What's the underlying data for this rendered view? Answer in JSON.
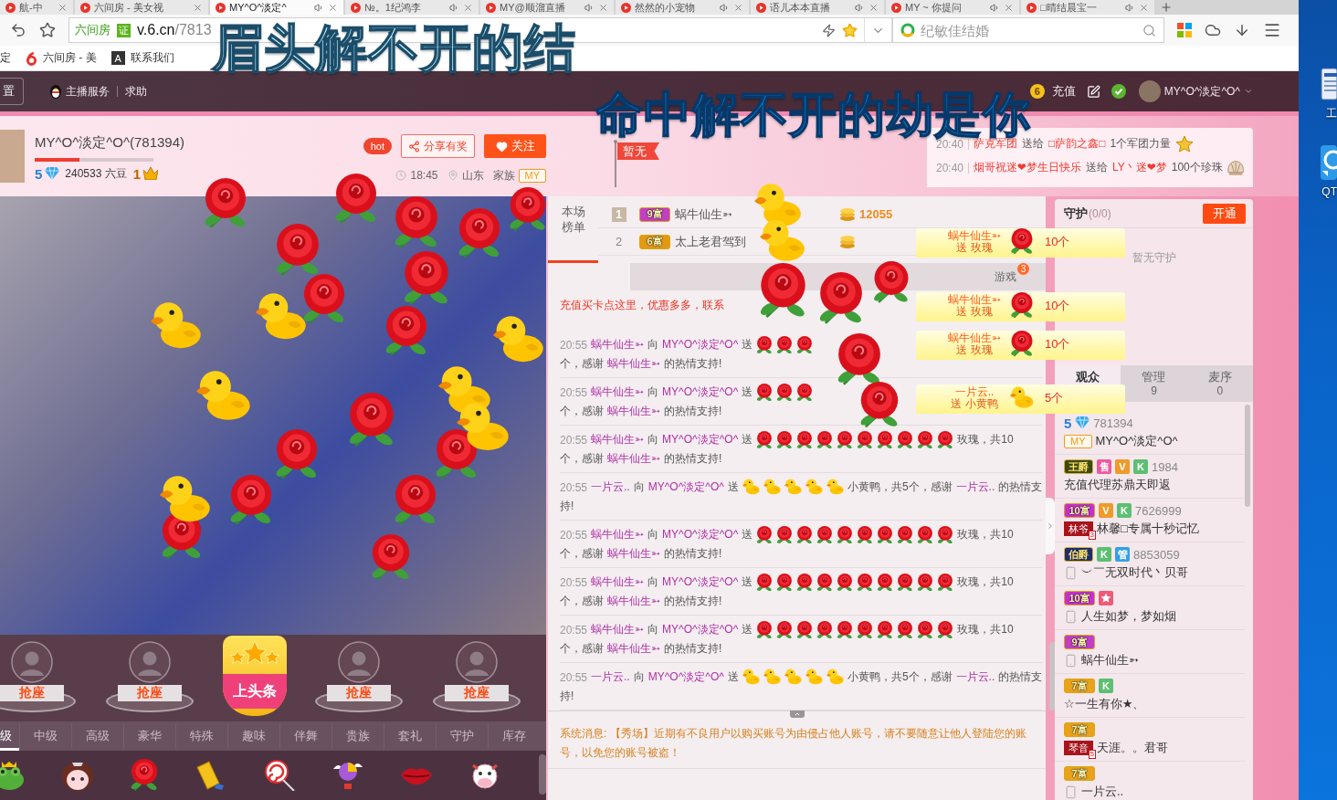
{
  "browser": {
    "tabs": [
      {
        "title": "航-中",
        "selected": false,
        "sound": false
      },
      {
        "title": "六间房 - 美女视",
        "selected": false,
        "sound": false
      },
      {
        "title": "MY^O^淡定^",
        "selected": true,
        "sound": true
      },
      {
        "title": "№。1纪鸿李",
        "selected": false,
        "sound": true
      },
      {
        "title": "MY@顺溜直播",
        "selected": false,
        "sound": true
      },
      {
        "title": "然然的小宠物",
        "selected": false,
        "sound": true
      },
      {
        "title": "语儿本本直播",
        "selected": false,
        "sound": true
      },
      {
        "title": "MY ~ 你提问",
        "selected": false,
        "sound": true
      },
      {
        "title": "□晴结晨宝一",
        "selected": false,
        "sound": true
      }
    ],
    "address": {
      "site": "六间房",
      "verified": "证",
      "host": "v.6.cn",
      "path": "/7813"
    },
    "favorite": true,
    "search": {
      "placeholder": "纪敏佳结婚"
    },
    "bookmarks": [
      {
        "kind": "plain",
        "label": "定"
      },
      {
        "kind": "six",
        "label": "六间房 - 美"
      },
      {
        "kind": "letter",
        "mark": "A",
        "label": "联系我们"
      }
    ]
  },
  "lyrics": [
    {
      "text": "眉头解不开的结",
      "active": false
    },
    {
      "text": "命中解不开的劫是你",
      "active": true
    }
  ],
  "site_nav": {
    "settings": "置",
    "service": "主播服务",
    "help": "求助",
    "coin_level": "6",
    "recharge": "充值",
    "verified": true,
    "user": "MY^O^淡定^O^"
  },
  "host": {
    "name": "MY^O^淡定^O^(781394)",
    "level": 0.38,
    "rank": "5",
    "beans": "240533 六豆",
    "crown": "1",
    "hot": "hot",
    "share": "分享有奖",
    "follow": "关注",
    "time": "18:45",
    "location": "山东",
    "family_label": "家族",
    "family": "MY"
  },
  "flag": "暂无",
  "feed": [
    {
      "time": "20:40",
      "from": "萨克军团",
      "verb": "送给",
      "to": "□萨韵之鑫□",
      "gift": "1个军团力量",
      "kind": "star"
    },
    {
      "time": "20:40",
      "from": "烟哥祝迷❤梦生日快乐",
      "verb": "送给",
      "to": "LY丶迷❤梦",
      "gift": "100个珍珠",
      "kind": "shell"
    }
  ],
  "seats": [
    {
      "kind": "seat",
      "label": "抢座"
    },
    {
      "kind": "seat",
      "label": "抢座"
    },
    {
      "kind": "headline",
      "label": "上头条"
    },
    {
      "kind": "seat",
      "label": "抢座"
    },
    {
      "kind": "seat",
      "label": "抢座"
    }
  ],
  "gift_tabs": [
    {
      "label": "级",
      "selected": true
    },
    {
      "label": "中级",
      "selected": false
    },
    {
      "label": "高级",
      "selected": false
    },
    {
      "label": "豪华",
      "selected": false
    },
    {
      "label": "特殊",
      "selected": false
    },
    {
      "label": "趣味",
      "selected": false
    },
    {
      "label": "伴舞",
      "selected": false
    },
    {
      "label": "贵族",
      "selected": false
    },
    {
      "label": "套礼",
      "selected": false
    },
    {
      "label": "守护",
      "selected": false
    },
    {
      "label": "库存",
      "selected": false
    }
  ],
  "gifts": [
    {
      "kind": "frog"
    },
    {
      "kind": "girl"
    },
    {
      "kind": "rose"
    },
    {
      "kind": "gold"
    },
    {
      "kind": "lollipop"
    },
    {
      "kind": "balloon"
    },
    {
      "kind": "lips"
    },
    {
      "kind": "cow"
    }
  ],
  "rank": {
    "title": "本场榜单",
    "rows": [
      {
        "rank": "1",
        "medal": true,
        "badge": {
          "text": "9富",
          "color": "#c23ec4"
        },
        "name": "蜗牛仙生➳",
        "score": "12055"
      },
      {
        "rank": "2",
        "medal": false,
        "badge": {
          "text": "6富",
          "color": "#e29a14"
        },
        "name": "太上老君驾到"
      }
    ]
  },
  "chat_tabs": [
    {
      "label": "游戏",
      "count": "3"
    }
  ],
  "notice": "充值买卡点这里，优惠多多，联系",
  "messages": [
    {
      "lines": [
        [
          {
            "kind": "time",
            "text": "20:55"
          },
          {
            "kind": "name",
            "text": "蜗牛仙生➳"
          },
          {
            "kind": "text",
            "text": "向"
          },
          {
            "kind": "name",
            "text": "MY^O^淡定^O^"
          },
          {
            "kind": "text",
            "text": "送"
          },
          {
            "kind": "rose"
          },
          {
            "kind": "rose"
          },
          {
            "kind": "rose"
          }
        ],
        [
          {
            "kind": "text",
            "text": "个，感谢"
          },
          {
            "kind": "name",
            "text": "蜗牛仙生➳"
          },
          {
            "kind": "text",
            "text": "的热情支持!"
          }
        ]
      ]
    },
    {
      "lines": [
        [
          {
            "kind": "time",
            "text": "20:55"
          },
          {
            "kind": "name",
            "text": "蜗牛仙生➳"
          },
          {
            "kind": "text",
            "text": "向"
          },
          {
            "kind": "name",
            "text": "MY^O^淡定^O^"
          },
          {
            "kind": "text",
            "text": "送"
          },
          {
            "kind": "rose"
          },
          {
            "kind": "rose"
          },
          {
            "kind": "rose"
          }
        ],
        [
          {
            "kind": "text",
            "text": "个，感谢"
          },
          {
            "kind": "name",
            "text": "蜗牛仙生➳"
          },
          {
            "kind": "text",
            "text": "的热情支持!"
          }
        ]
      ]
    },
    {
      "lines": [
        [
          {
            "kind": "time",
            "text": "20:55"
          },
          {
            "kind": "name",
            "text": "蜗牛仙生➳"
          },
          {
            "kind": "text",
            "text": "向"
          },
          {
            "kind": "name",
            "text": "MY^O^淡定^O^"
          },
          {
            "kind": "text",
            "text": "送"
          },
          {
            "kind": "rose"
          },
          {
            "kind": "rose"
          },
          {
            "kind": "rose"
          },
          {
            "kind": "rose"
          },
          {
            "kind": "rose"
          },
          {
            "kind": "rose"
          },
          {
            "kind": "rose"
          },
          {
            "kind": "rose"
          },
          {
            "kind": "rose"
          },
          {
            "kind": "rose"
          },
          {
            "kind": "text",
            "text": "玫瑰，共10"
          }
        ],
        [
          {
            "kind": "text",
            "text": "个，感谢"
          },
          {
            "kind": "name",
            "text": "蜗牛仙生➳"
          },
          {
            "kind": "text",
            "text": "的热情支持!"
          }
        ]
      ]
    },
    {
      "lines": [
        [
          {
            "kind": "time",
            "text": "20:55"
          },
          {
            "kind": "name",
            "text": "一片云.."
          },
          {
            "kind": "text",
            "text": "向"
          },
          {
            "kind": "name",
            "text": "MY^O^淡定^O^"
          },
          {
            "kind": "text",
            "text": "送"
          },
          {
            "kind": "duck"
          },
          {
            "kind": "duck"
          },
          {
            "kind": "duck"
          },
          {
            "kind": "duck"
          },
          {
            "kind": "duck"
          },
          {
            "kind": "text",
            "text": "小黄鸭，共5个，感谢"
          },
          {
            "kind": "name",
            "text": "一片云.."
          },
          {
            "kind": "text",
            "text": "的热情支"
          }
        ],
        [
          {
            "kind": "text",
            "text": "持!"
          }
        ]
      ]
    },
    {
      "lines": [
        [
          {
            "kind": "time",
            "text": "20:55"
          },
          {
            "kind": "name",
            "text": "蜗牛仙生➳"
          },
          {
            "kind": "text",
            "text": "向"
          },
          {
            "kind": "name",
            "text": "MY^O^淡定^O^"
          },
          {
            "kind": "text",
            "text": "送"
          },
          {
            "kind": "rose"
          },
          {
            "kind": "rose"
          },
          {
            "kind": "rose"
          },
          {
            "kind": "rose"
          },
          {
            "kind": "rose"
          },
          {
            "kind": "rose"
          },
          {
            "kind": "rose"
          },
          {
            "kind": "rose"
          },
          {
            "kind": "rose"
          },
          {
            "kind": "rose"
          },
          {
            "kind": "text",
            "text": "玫瑰，共10"
          }
        ],
        [
          {
            "kind": "text",
            "text": "个，感谢"
          },
          {
            "kind": "name",
            "text": "蜗牛仙生➳"
          },
          {
            "kind": "text",
            "text": "的热情支持!"
          }
        ]
      ]
    },
    {
      "lines": [
        [
          {
            "kind": "time",
            "text": "20:55"
          },
          {
            "kind": "name",
            "text": "蜗牛仙生➳"
          },
          {
            "kind": "text",
            "text": "向"
          },
          {
            "kind": "name",
            "text": "MY^O^淡定^O^"
          },
          {
            "kind": "text",
            "text": "送"
          },
          {
            "kind": "rose"
          },
          {
            "kind": "rose"
          },
          {
            "kind": "rose"
          },
          {
            "kind": "rose"
          },
          {
            "kind": "rose"
          },
          {
            "kind": "rose"
          },
          {
            "kind": "rose"
          },
          {
            "kind": "rose"
          },
          {
            "kind": "rose"
          },
          {
            "kind": "rose"
          },
          {
            "kind": "text",
            "text": "玫瑰，共10"
          }
        ],
        [
          {
            "kind": "text",
            "text": "个，感谢"
          },
          {
            "kind": "name",
            "text": "蜗牛仙生➳"
          },
          {
            "kind": "text",
            "text": "的热情支持!"
          }
        ]
      ]
    },
    {
      "lines": [
        [
          {
            "kind": "time",
            "text": "20:55"
          },
          {
            "kind": "name",
            "text": "蜗牛仙生➳"
          },
          {
            "kind": "text",
            "text": "向"
          },
          {
            "kind": "name",
            "text": "MY^O^淡定^O^"
          },
          {
            "kind": "text",
            "text": "送"
          },
          {
            "kind": "rose"
          },
          {
            "kind": "rose"
          },
          {
            "kind": "rose"
          },
          {
            "kind": "rose"
          },
          {
            "kind": "rose"
          },
          {
            "kind": "rose"
          },
          {
            "kind": "rose"
          },
          {
            "kind": "rose"
          },
          {
            "kind": "rose"
          },
          {
            "kind": "rose"
          },
          {
            "kind": "text",
            "text": "玫瑰，共10"
          }
        ],
        [
          {
            "kind": "text",
            "text": "个，感谢"
          },
          {
            "kind": "name",
            "text": "蜗牛仙生➳"
          },
          {
            "kind": "text",
            "text": "的热情支持!"
          }
        ]
      ]
    },
    {
      "lines": [
        [
          {
            "kind": "time",
            "text": "20:55"
          },
          {
            "kind": "name",
            "text": "一片云.."
          },
          {
            "kind": "text",
            "text": "向"
          },
          {
            "kind": "name",
            "text": "MY^O^淡定^O^"
          },
          {
            "kind": "text",
            "text": "送"
          },
          {
            "kind": "duck"
          },
          {
            "kind": "duck"
          },
          {
            "kind": "duck"
          },
          {
            "kind": "duck"
          },
          {
            "kind": "duck"
          },
          {
            "kind": "text",
            "text": "小黄鸭，共5个，感谢"
          },
          {
            "kind": "name",
            "text": "一片云.."
          },
          {
            "kind": "text",
            "text": "的热情支"
          }
        ],
        [
          {
            "kind": "text",
            "text": "持!"
          }
        ]
      ]
    }
  ],
  "system_message": "系统消息: 【秀场】近期有不良用户以购买账号为由侵占他人账号，请不要随意让他人登陆您的账号，以免您的账号被盗！",
  "gift_banners": [
    {
      "name": "蜗牛仙生➳",
      "action": "送 玫瑰",
      "kind": "rose",
      "count": "10个"
    },
    {
      "name": "蜗牛仙生➳",
      "action": "送 玫瑰",
      "kind": "rose",
      "count": "10个"
    },
    {
      "name": "蜗牛仙生➳",
      "action": "送 玫瑰",
      "kind": "rose",
      "count": "10个"
    },
    {
      "name": "一片云..",
      "action": "送 小黄鸭",
      "kind": "duck",
      "count": "5个"
    }
  ],
  "guard": {
    "title": "守护",
    "count": "(0/0)",
    "open": "开通",
    "empty": "暂无守护"
  },
  "audience_tabs": [
    {
      "label": "观众",
      "selected": true
    },
    {
      "label": "管理",
      "count": "9",
      "selected": false
    },
    {
      "label": "麦序",
      "count": "0",
      "selected": false
    }
  ],
  "audience": [
    {
      "badges": [
        {
          "kind": "diamond",
          "text": "5",
          "color": "#2a7fd4"
        }
      ],
      "id": "781394",
      "tag": {
        "kind": "family",
        "text": "MY"
      },
      "name": "MY^O^淡定^O^"
    },
    {
      "badges": [
        {
          "kind": "title",
          "text": "王爵",
          "color": "#3d4a12"
        },
        {
          "kind": "letter",
          "text": "售",
          "color": "#ee5a9e"
        },
        {
          "kind": "letter",
          "text": "V",
          "color": "#f09a2a"
        },
        {
          "kind": "letter",
          "text": "K",
          "color": "#5cbf72"
        }
      ],
      "id": "1984",
      "name": "充值代理苏鼎天即返"
    },
    {
      "badges": [
        {
          "kind": "wealth",
          "text": "10富",
          "color": "#c82fd0"
        },
        {
          "kind": "letter",
          "text": "V",
          "color": "#f09a2a"
        },
        {
          "kind": "letter",
          "text": "K",
          "color": "#5cbf72"
        }
      ],
      "id": "7626999",
      "tag": {
        "kind": "club",
        "text": "林爷",
        "sub": "3"
      },
      "name": "林馨□专属十秒记忆"
    },
    {
      "badges": [
        {
          "kind": "title",
          "text": "伯爵",
          "color": "#1e2d6a"
        },
        {
          "kind": "letter",
          "text": "K",
          "color": "#5cbf72"
        },
        {
          "kind": "letter",
          "text": "管",
          "color": "#34a0e6"
        }
      ],
      "id": "8853059",
      "tag": {
        "kind": "phone"
      },
      "name": "︶￣无双时代丶贝哥"
    },
    {
      "badges": [
        {
          "kind": "wealth",
          "text": "10富",
          "color": "#c82fd0"
        },
        {
          "kind": "star",
          "color": "#f05a78"
        }
      ],
      "tag": {
        "kind": "phone"
      },
      "name": "人生如梦，梦如烟"
    },
    {
      "badges": [
        {
          "kind": "wealth",
          "text": "9富",
          "color": "#c23ec4"
        }
      ],
      "tag": {
        "kind": "phone"
      },
      "name": "蜗牛仙生➳"
    },
    {
      "badges": [
        {
          "kind": "wealth",
          "text": "7富",
          "color": "#e9a21c"
        },
        {
          "kind": "letter",
          "text": "K",
          "color": "#5cbf72"
        }
      ],
      "name": "☆一生有你★、"
    },
    {
      "badges": [
        {
          "kind": "wealth",
          "text": "7富",
          "color": "#e9a21c"
        }
      ],
      "tag": {
        "kind": "club",
        "text": "琴音",
        "sub": "5"
      },
      "name": "天涯。。君哥"
    },
    {
      "badges": [
        {
          "kind": "wealth",
          "text": "7富",
          "color": "#e9a21c"
        }
      ],
      "tag": {
        "kind": "phone"
      },
      "name": "一片云.."
    }
  ],
  "desktop": [
    {
      "label": "工",
      "kind": "document"
    },
    {
      "label": "QT",
      "kind": "chat"
    }
  ]
}
